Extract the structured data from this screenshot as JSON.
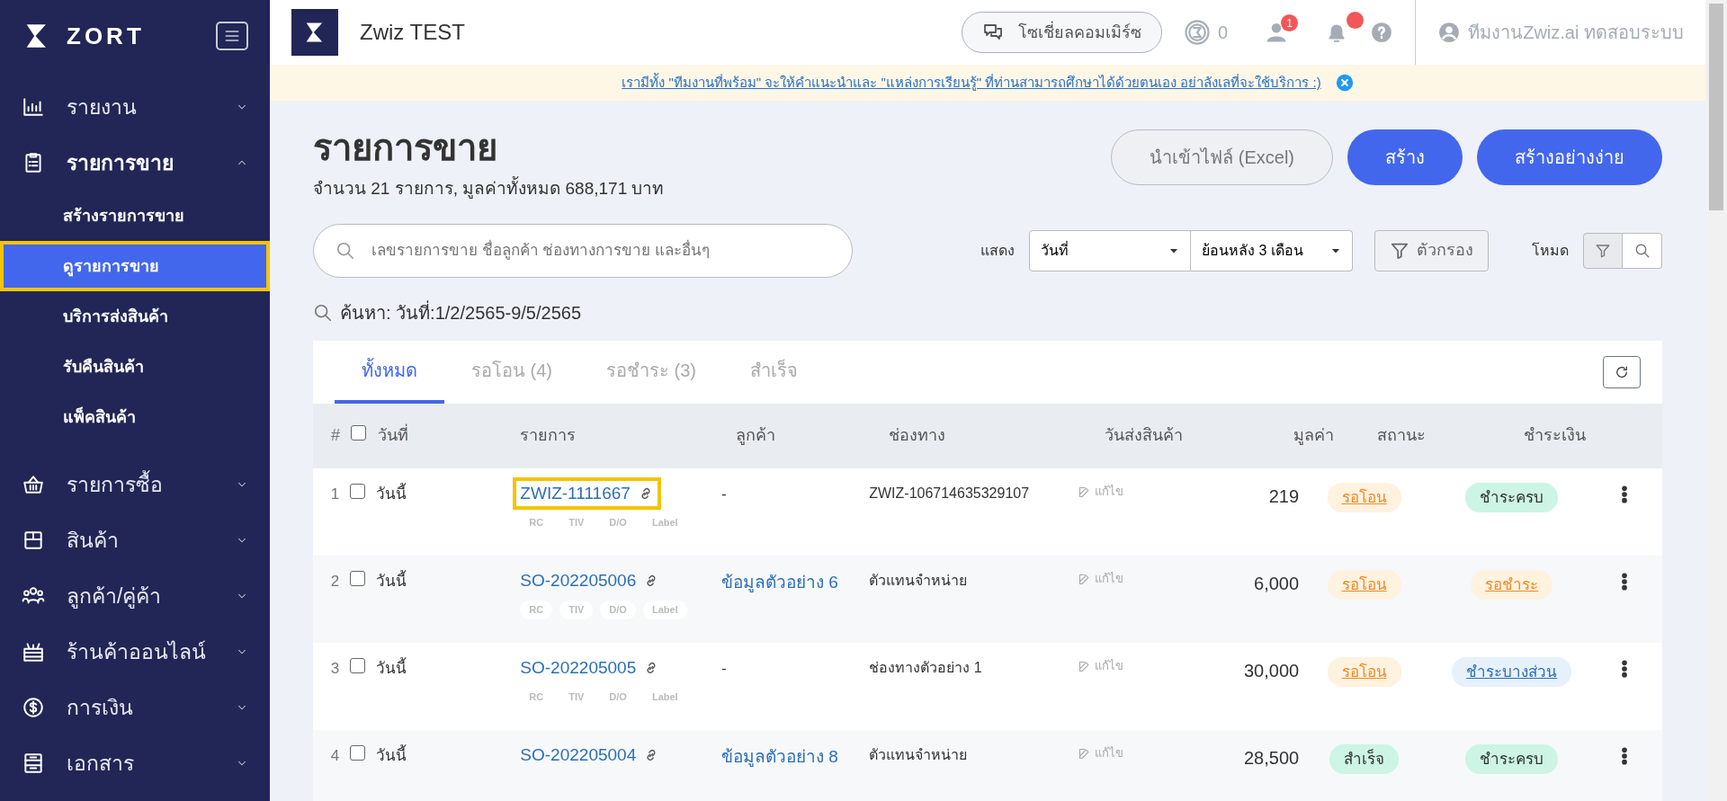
{
  "sidebar": {
    "brand": "ZORT",
    "items": [
      {
        "label": "รายงาน",
        "expanded": false
      },
      {
        "label": "รายการขาย",
        "expanded": true,
        "children": [
          {
            "label": "สร้างรายการขาย",
            "selected": false,
            "highlighted": false
          },
          {
            "label": "ดูรายการขาย",
            "selected": true,
            "highlighted": true
          },
          {
            "label": "บริการส่งสินค้า",
            "selected": false,
            "highlighted": false
          },
          {
            "label": "รับคืนสินค้า",
            "selected": false,
            "highlighted": false
          },
          {
            "label": "แพ็คสินค้า",
            "selected": false,
            "highlighted": false
          }
        ]
      },
      {
        "label": "รายการซื้อ",
        "expanded": false
      },
      {
        "label": "สินค้า",
        "expanded": false
      },
      {
        "label": "ลูกค้า/คู่ค้า",
        "expanded": false
      },
      {
        "label": "ร้านค้าออนไลน์",
        "expanded": false
      },
      {
        "label": "การเงิน",
        "expanded": false
      },
      {
        "label": "เอกสาร",
        "expanded": false
      }
    ]
  },
  "topbar": {
    "shop_name": "Zwiz TEST",
    "social_button": "โซเชี่ยลคอมเมิร์ซ",
    "coins": "0",
    "contacts_badge": "1",
    "bell_alert": true,
    "user_name": "ทีมงานZwiz.ai ทดสอบระบบ"
  },
  "banner": {
    "text": "เรามีทั้ง \"ทีมงานที่พร้อม\" จะให้คำแนะนำและ \"แหล่งการเรียนรู้\" ที่ท่านสามารถศึกษาได้ด้วยตนเอง อย่าลังเลที่จะใช้บริการ :)"
  },
  "page": {
    "title": "รายการขาย",
    "summary": "จำนวน 21 รายการ, มูลค่าทั้งหมด 688,171 บาท",
    "buttons": [
      {
        "label": "นำเข้าไฟล์ (Excel)",
        "kind": "outline"
      },
      {
        "label": "สร้าง",
        "kind": "primary"
      },
      {
        "label": "สร้างอย่างง่าย",
        "kind": "primary"
      }
    ]
  },
  "filters": {
    "search_placeholder": "เลขรายการขาย ชื่อลูกค้า ช่องทางการขาย และอื่นๆ",
    "show_label": "แสดง",
    "date_field": "วันที่",
    "range": "ย้อนหลัง 3 เดือน",
    "filter_button": "ตัวกรอง",
    "mode_label": "โหมด",
    "mode_buttons": [
      {
        "selected": true
      },
      {
        "selected": false
      }
    ]
  },
  "search_summary": "ค้นหา: วันที่:1/2/2565-9/5/2565",
  "tabs": [
    {
      "label": "ทั้งหมด",
      "selected": true
    },
    {
      "label": "รอโอน (4)",
      "selected": false
    },
    {
      "label": "รอชำระ (3)",
      "selected": false
    },
    {
      "label": "สำเร็จ",
      "selected": false
    }
  ],
  "table": {
    "select_all_checked": false,
    "columns": [
      "#",
      "วันที่",
      "รายการ",
      "ลูกค้า",
      "ช่องทาง",
      "วันส่งสินค้า",
      "มูลค่า",
      "สถานะ",
      "ชำระเงิน"
    ],
    "rows": [
      {
        "index": "1",
        "checked": false,
        "date": "วันนี้",
        "order": "ZWIZ-1111667",
        "highlighted": true,
        "tags": [
          "RC",
          "TIV",
          "D/O",
          "Label"
        ],
        "customer": "-",
        "customer_link": false,
        "channel": "ZWIZ-106714635329107",
        "ship": "แก้ไข",
        "value": "219",
        "status": {
          "text": "รอโอน",
          "kind": "pending"
        },
        "payment": {
          "text": "ชำระครบ",
          "kind": "paid"
        }
      },
      {
        "index": "2",
        "checked": false,
        "date": "วันนี้",
        "order": "SO-202205006",
        "highlighted": false,
        "tags": [
          "RC",
          "TIV",
          "D/O",
          "Label"
        ],
        "customer": "ข้อมูลตัวอย่าง 6",
        "customer_link": true,
        "channel": "ตัวแทนจำหน่าย",
        "ship": "แก้ไข",
        "value": "6,000",
        "status": {
          "text": "รอโอน",
          "kind": "pending"
        },
        "payment": {
          "text": "รอชำระ",
          "kind": "unpaid"
        }
      },
      {
        "index": "3",
        "checked": false,
        "date": "วันนี้",
        "order": "SO-202205005",
        "highlighted": false,
        "tags": [
          "RC",
          "TIV",
          "D/O",
          "Label"
        ],
        "customer": "-",
        "customer_link": false,
        "channel": "ช่องทางตัวอย่าง 1",
        "ship": "แก้ไข",
        "value": "30,000",
        "status": {
          "text": "รอโอน",
          "kind": "pending"
        },
        "payment": {
          "text": "ชำระบางส่วน",
          "kind": "partial"
        }
      },
      {
        "index": "4",
        "checked": false,
        "date": "วันนี้",
        "order": "SO-202205004",
        "highlighted": false,
        "customer": "ข้อมูลตัวอย่าง 8",
        "customer_link": true,
        "channel": "ตัวแทนจำหน่าย",
        "ship": "แก้ไข",
        "value": "28,500",
        "status": {
          "text": "สำเร็จ",
          "kind": "done"
        },
        "payment": {
          "text": "ชำระครบ",
          "kind": "paid"
        }
      }
    ]
  }
}
